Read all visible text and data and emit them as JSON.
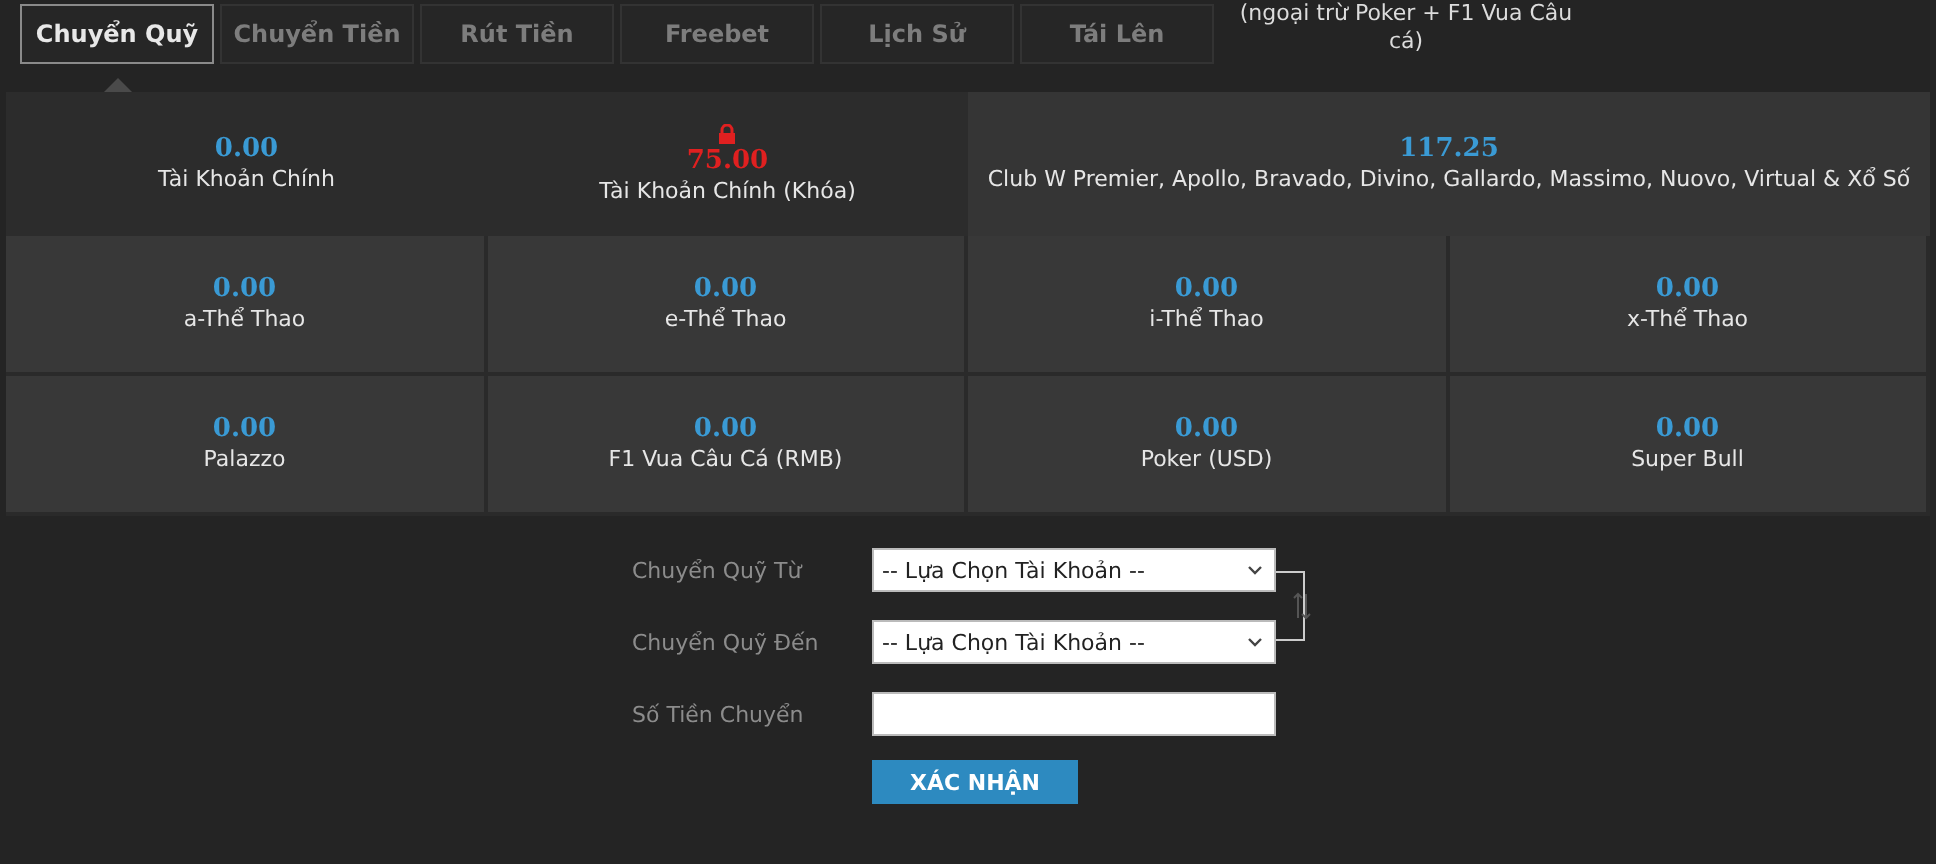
{
  "tabs": [
    {
      "label": "Chuyển Quỹ",
      "selected": true
    },
    {
      "label": "Chuyển Tiền",
      "selected": false
    },
    {
      "label": "Rút Tiền",
      "selected": false
    },
    {
      "label": "Freebet",
      "selected": false
    },
    {
      "label": "Lịch Sử",
      "selected": false
    },
    {
      "label": "Tái Lên",
      "selected": false
    }
  ],
  "tab_note": "(ngoại trừ Poker + F1 Vua Câu cá)",
  "balance_rows": [
    [
      {
        "amount": "0.00",
        "label": "Tài Khoản Chính",
        "locked": false
      },
      {
        "amount": "75.00",
        "label": "Tài Khoản Chính (Khóa)",
        "locked": true
      },
      {
        "amount": "117.25",
        "label": "Club W Premier, Apollo, Bravado, Divino, Gallardo, Massimo, Nuovo, Virtual & Xổ Số",
        "locked": false
      }
    ],
    [
      {
        "amount": "0.00",
        "label": "a-Thể Thao",
        "locked": false
      },
      {
        "amount": "0.00",
        "label": "e-Thể Thao",
        "locked": false
      },
      {
        "amount": "0.00",
        "label": "i-Thể Thao",
        "locked": false
      },
      {
        "amount": "0.00",
        "label": "x-Thể Thao",
        "locked": false
      }
    ],
    [
      {
        "amount": "0.00",
        "label": "Palazzo",
        "locked": false
      },
      {
        "amount": "0.00",
        "label": "F1 Vua Câu Cá (RMB)",
        "locked": false
      },
      {
        "amount": "0.00",
        "label": "Poker (USD)",
        "locked": false
      },
      {
        "amount": "0.00",
        "label": "Super Bull",
        "locked": false
      }
    ]
  ],
  "form": {
    "fields": [
      {
        "kind": "select",
        "label": "Chuyển Quỹ Từ",
        "value": "-- Lựa Chọn Tài Khoản --"
      },
      {
        "kind": "select",
        "label": "Chuyển Quỹ Đến",
        "value": "-- Lựa Chọn Tài Khoản --"
      },
      {
        "kind": "input",
        "label": "Số Tiền Chuyển"
      }
    ],
    "submit": "XÁC NHẬN"
  }
}
